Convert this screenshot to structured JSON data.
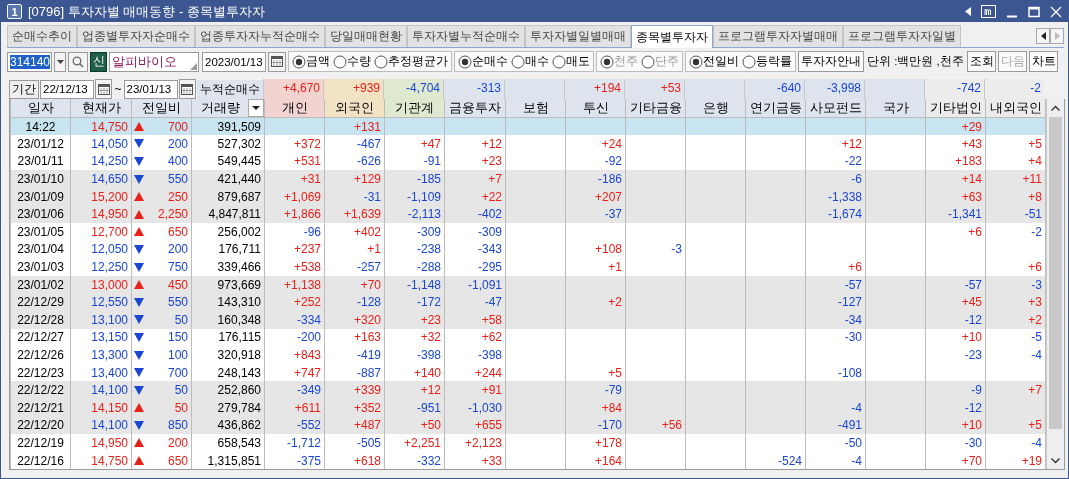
{
  "window": {
    "badge": "1",
    "title": "[0796] 투자자별 매매동향 - 종목별투자자"
  },
  "tabs": [
    {
      "label": "순매수추이",
      "selected": false
    },
    {
      "label": "업종별투자자순매수",
      "selected": false
    },
    {
      "label": "업종투자자누적순매수",
      "selected": false
    },
    {
      "label": "당일매매현황",
      "selected": false
    },
    {
      "label": "투자자별누적순매수",
      "selected": false
    },
    {
      "label": "투자자별일별매매",
      "selected": false
    },
    {
      "label": "종목별투자자",
      "selected": true
    },
    {
      "label": "프로그램투자자별매매",
      "selected": false
    },
    {
      "label": "프로그램투자자일별",
      "selected": false
    }
  ],
  "controls": {
    "code": {
      "value": "314140",
      "highlighted": true
    },
    "market_badge": "신",
    "name": "알피바이오",
    "date": "2023/01/13",
    "option_groups": [
      {
        "disabled": false,
        "options": [
          {
            "label": "금액",
            "selected": true
          },
          {
            "label": "수량",
            "selected": false
          },
          {
            "label": "추정평균가",
            "selected": false
          }
        ]
      },
      {
        "disabled": false,
        "options": [
          {
            "label": "순매수",
            "selected": true
          },
          {
            "label": "매수",
            "selected": false
          },
          {
            "label": "매도",
            "selected": false
          }
        ]
      },
      {
        "disabled": true,
        "options": [
          {
            "label": "천주",
            "selected": true
          },
          {
            "label": "단주",
            "selected": false
          }
        ]
      },
      {
        "disabled": false,
        "options": [
          {
            "label": "전일비",
            "selected": true
          },
          {
            "label": "등락률",
            "selected": false
          }
        ]
      }
    ],
    "guide_button": "투자자안내",
    "unit": "단위 :백만원 ,천주",
    "buttons": [
      {
        "label": "조회",
        "disabled": false
      },
      {
        "label": "다음",
        "disabled": true
      },
      {
        "label": "차트",
        "disabled": false
      }
    ]
  },
  "period": {
    "label": "기간",
    "from": "22/12/13",
    "separator": "~",
    "to": "23/01/13",
    "summary_label": "누적순매수"
  },
  "table": {
    "columns": [
      {
        "label": "일자",
        "color": "#dde4ee"
      },
      {
        "label": "현재가",
        "color": "#dde4ee"
      },
      {
        "label": "전일비",
        "color": "#dde4ee"
      },
      {
        "label": "거래량",
        "color": "#dde4ee"
      },
      {
        "label": "개인",
        "color": "#f3d3cf",
        "total": "+4,670"
      },
      {
        "label": "외국인",
        "color": "#f1e2c3",
        "total": "+939"
      },
      {
        "label": "기관계",
        "color": "#dfe9cf",
        "total": "-4,704"
      },
      {
        "label": "금융투자",
        "color": "#dde4ee",
        "total": "-313"
      },
      {
        "label": "보험",
        "color": "#dde4ee"
      },
      {
        "label": "투신",
        "color": "#dde4ee",
        "total": "+194"
      },
      {
        "label": "기타금융",
        "color": "#dde4ee",
        "total": "+53"
      },
      {
        "label": "은행",
        "color": "#dde4ee"
      },
      {
        "label": "연기금등",
        "color": "#dde4ee",
        "total": "-640"
      },
      {
        "label": "사모펀드",
        "color": "#dde4ee",
        "total": "-3,998"
      },
      {
        "label": "국가",
        "color": "#dde4ee"
      },
      {
        "label": "기타법인",
        "color": "#ececec",
        "total": "-742"
      },
      {
        "label": "내외국인",
        "color": "#ececec",
        "total": "-2"
      }
    ],
    "rows": [
      {
        "selected": true,
        "kind": "up",
        "cells": [
          "14:22",
          "14,750",
          "700",
          "391,509",
          "",
          "+131",
          "",
          "",
          "",
          "",
          "",
          "",
          "",
          "",
          "",
          "+29",
          ""
        ]
      },
      {
        "selected": false,
        "kind": "down",
        "cells": [
          "23/01/12",
          "14,050",
          "200",
          "527,302",
          "+372",
          "-467",
          "+47",
          "+12",
          "",
          "+24",
          "",
          "",
          "",
          "+12",
          "",
          "+43",
          "+5"
        ]
      },
      {
        "selected": false,
        "kind": "down",
        "cells": [
          "23/01/11",
          "14,250",
          "400",
          "549,445",
          "+531",
          "-626",
          "-91",
          "+23",
          "",
          "-92",
          "",
          "",
          "",
          "-22",
          "",
          "+183",
          "+4"
        ]
      },
      {
        "selected": false,
        "kind": "down",
        "cells": [
          "23/01/10",
          "14,650",
          "550",
          "421,440",
          "+31",
          "+129",
          "-185",
          "+7",
          "",
          "-186",
          "",
          "",
          "",
          "-6",
          "",
          "+14",
          "+11"
        ]
      },
      {
        "selected": false,
        "kind": "up",
        "cells": [
          "23/01/09",
          "15,200",
          "250",
          "879,687",
          "+1,069",
          "-31",
          "-1,109",
          "+22",
          "",
          "+207",
          "",
          "",
          "",
          "-1,338",
          "",
          "+63",
          "+8"
        ]
      },
      {
        "selected": false,
        "kind": "up",
        "cells": [
          "23/01/06",
          "14,950",
          "2,250",
          "4,847,811",
          "+1,866",
          "+1,639",
          "-2,113",
          "-402",
          "",
          "-37",
          "",
          "",
          "",
          "-1,674",
          "",
          "-1,341",
          "-51"
        ]
      },
      {
        "selected": false,
        "kind": "up",
        "cells": [
          "23/01/05",
          "12,700",
          "650",
          "256,002",
          "-96",
          "+402",
          "-309",
          "-309",
          "",
          "",
          "",
          "",
          "",
          "",
          "",
          "+6",
          "-2"
        ]
      },
      {
        "selected": false,
        "kind": "down",
        "cells": [
          "23/01/04",
          "12,050",
          "200",
          "176,711",
          "+237",
          "+1",
          "-238",
          "-343",
          "",
          "+108",
          "-3",
          "",
          "",
          "",
          "",
          "",
          ""
        ]
      },
      {
        "selected": false,
        "kind": "down",
        "cells": [
          "23/01/03",
          "12,250",
          "750",
          "339,466",
          "+538",
          "-257",
          "-288",
          "-295",
          "",
          "+1",
          "",
          "",
          "",
          "+6",
          "",
          "",
          "+6"
        ]
      },
      {
        "selected": false,
        "kind": "up",
        "cells": [
          "23/01/02",
          "13,000",
          "450",
          "973,669",
          "+1,138",
          "+70",
          "-1,148",
          "-1,091",
          "",
          "",
          "",
          "",
          "",
          "-57",
          "",
          "-57",
          "-3"
        ]
      },
      {
        "selected": false,
        "kind": "down",
        "cells": [
          "22/12/29",
          "12,550",
          "550",
          "143,310",
          "+252",
          "-128",
          "-172",
          "-47",
          "",
          "+2",
          "",
          "",
          "",
          "-127",
          "",
          "+45",
          "+3"
        ]
      },
      {
        "selected": false,
        "kind": "down",
        "cells": [
          "22/12/28",
          "13,100",
          "50",
          "160,348",
          "-334",
          "+320",
          "+23",
          "+58",
          "",
          "",
          "",
          "",
          "",
          "-34",
          "",
          "-12",
          "+2"
        ]
      },
      {
        "selected": false,
        "kind": "down",
        "cells": [
          "22/12/27",
          "13,150",
          "150",
          "176,115",
          "-200",
          "+163",
          "+32",
          "+62",
          "",
          "",
          "",
          "",
          "",
          "-30",
          "",
          "+10",
          "-5"
        ]
      },
      {
        "selected": false,
        "kind": "down",
        "cells": [
          "22/12/26",
          "13,300",
          "100",
          "320,918",
          "+843",
          "-419",
          "-398",
          "-398",
          "",
          "",
          "",
          "",
          "",
          "",
          "",
          "-23",
          "-4"
        ]
      },
      {
        "selected": false,
        "kind": "down",
        "cells": [
          "22/12/23",
          "13,400",
          "700",
          "248,143",
          "+747",
          "-887",
          "+140",
          "+244",
          "",
          "+5",
          "",
          "",
          "",
          "-108",
          "",
          "",
          ""
        ]
      },
      {
        "selected": false,
        "kind": "down",
        "cells": [
          "22/12/22",
          "14,100",
          "50",
          "252,860",
          "-349",
          "+339",
          "+12",
          "+91",
          "",
          "-79",
          "",
          "",
          "",
          "",
          "",
          "-9",
          "+7"
        ]
      },
      {
        "selected": false,
        "kind": "up",
        "cells": [
          "22/12/21",
          "14,150",
          "50",
          "279,784",
          "+611",
          "+352",
          "-951",
          "-1,030",
          "",
          "+84",
          "",
          "",
          "",
          "-4",
          "",
          "-12",
          ""
        ]
      },
      {
        "selected": false,
        "kind": "down",
        "cells": [
          "22/12/20",
          "14,100",
          "850",
          "436,862",
          "-552",
          "+487",
          "+50",
          "+655",
          "",
          "-170",
          "+56",
          "",
          "",
          "-491",
          "",
          "+10",
          "+5"
        ]
      },
      {
        "selected": false,
        "kind": "up",
        "cells": [
          "22/12/19",
          "14,950",
          "200",
          "658,543",
          "-1,712",
          "-505",
          "+2,251",
          "+2,123",
          "",
          "+178",
          "",
          "",
          "",
          "-50",
          "",
          "-30",
          "-4"
        ]
      },
      {
        "selected": false,
        "kind": "up",
        "cells": [
          "22/12/16",
          "14,750",
          "650",
          "1,315,851",
          "-375",
          "+618",
          "-332",
          "+33",
          "",
          "+164",
          "",
          "",
          "-524",
          "-4",
          "",
          "+70",
          "+19"
        ]
      }
    ]
  }
}
